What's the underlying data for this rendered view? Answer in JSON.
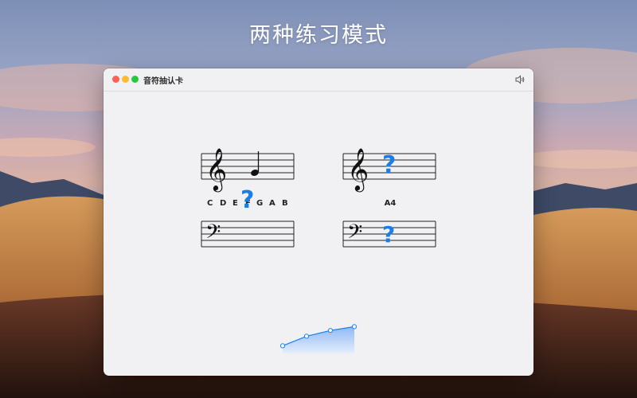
{
  "headline": "两种练习模式",
  "window": {
    "title": "音符抽认卡",
    "sound_icon": "speaker-icon"
  },
  "colors": {
    "accent": "#1a7ee8",
    "window_bg": "#f1f1f3"
  },
  "mode_one": {
    "clef_top": "treble",
    "clef_bottom": "bass",
    "note_options": [
      "C",
      "D",
      "E",
      "F",
      "G",
      "A",
      "B"
    ],
    "question_mark": "?"
  },
  "mode_two": {
    "clef_top": "treble",
    "clef_bottom": "bass",
    "answer": "A4",
    "question_mark": "?"
  },
  "progress_chart": {
    "points": [
      0.2,
      0.45,
      0.6,
      0.7
    ]
  }
}
